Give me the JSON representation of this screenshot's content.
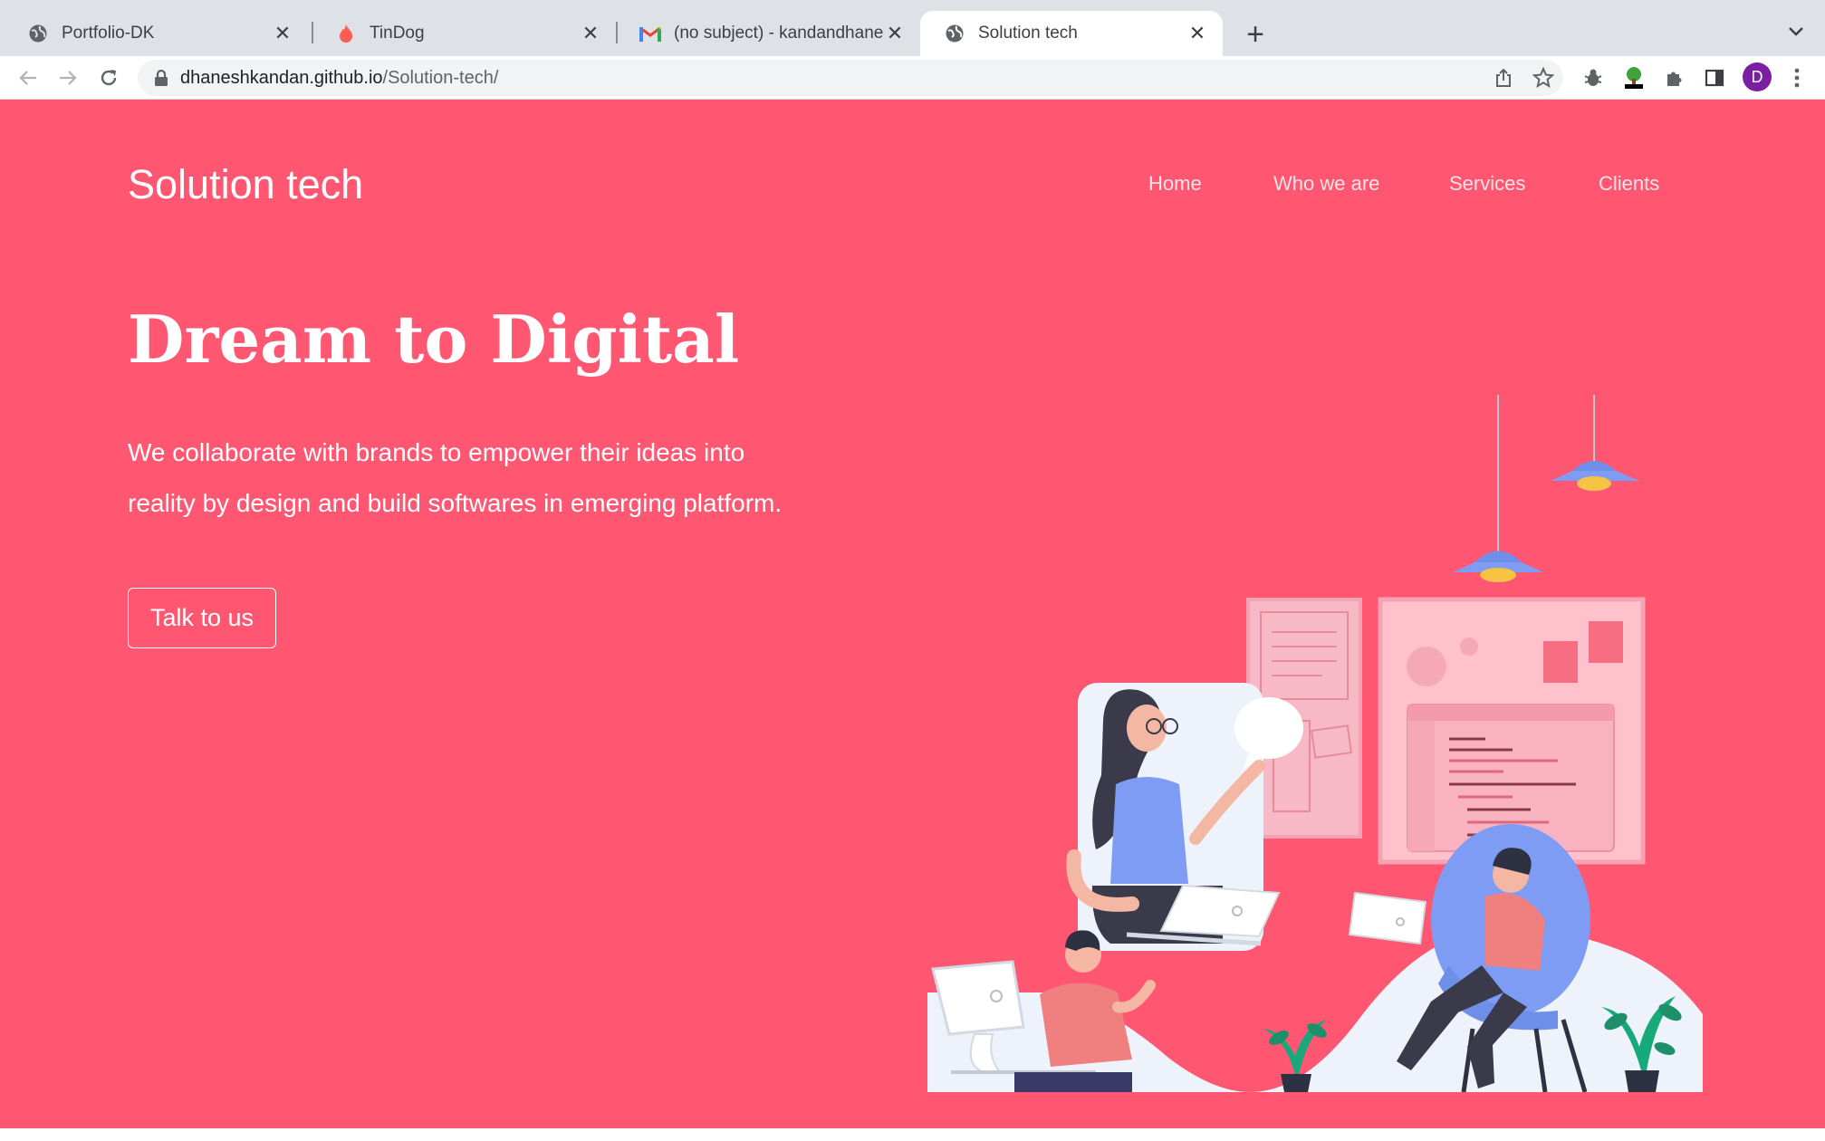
{
  "browser": {
    "tabs": [
      {
        "title": "Portfolio-DK",
        "icon": "globe-icon"
      },
      {
        "title": "TinDog",
        "icon": "flame-icon"
      },
      {
        "title": "(no subject) - kandandhanesh©",
        "icon": "gmail-icon"
      },
      {
        "title": "Solution tech",
        "icon": "globe-icon",
        "active": true
      }
    ],
    "url_host": "dhaneshkandan.github.io",
    "url_path": "/Solution-tech/",
    "profile_initial": "D"
  },
  "site": {
    "brand": "Solution tech",
    "nav": [
      "Home",
      "Who we are",
      "Services",
      "Clients"
    ],
    "hero_title": "Dream to Digital",
    "hero_line1": "We collaborate with brands to empower their ideas into",
    "hero_line2": "reality by design and build softwares in emerging platform.",
    "cta_label": "Talk to us"
  },
  "colors": {
    "page_bg": "#ff5672",
    "tab_strip": "#dee1e6",
    "accent_blue": "#7f9cf5",
    "lamp_yellow": "#f6c343",
    "panel_pink": "#ffc1cc",
    "profile_purple": "#7b1fa2"
  }
}
